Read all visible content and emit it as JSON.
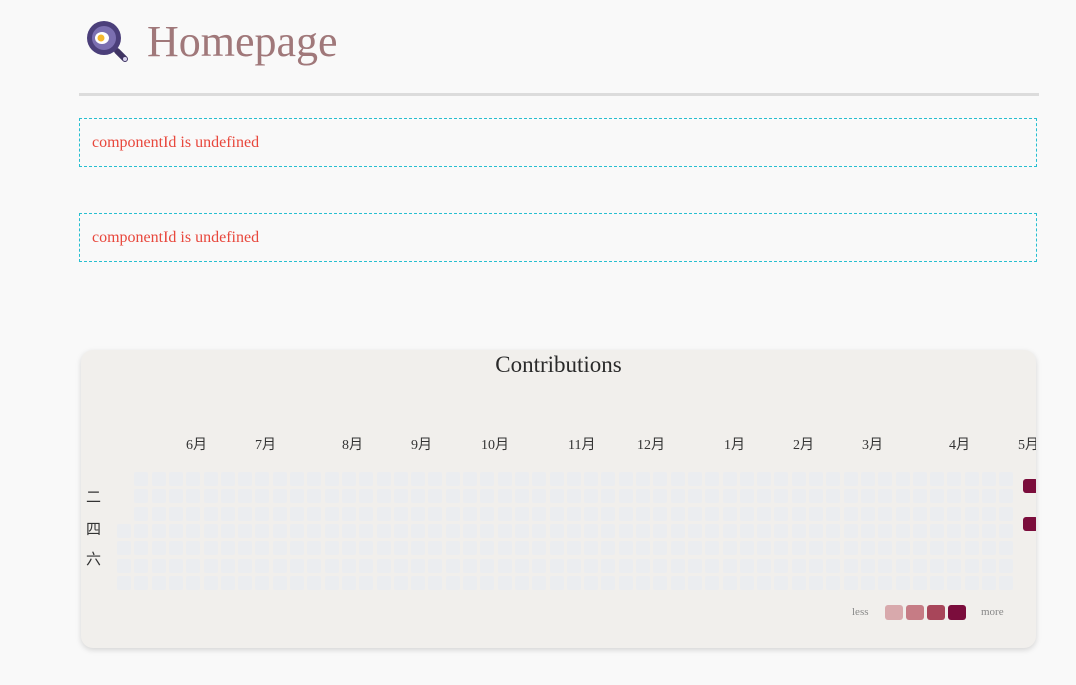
{
  "header": {
    "title": "Homepage",
    "logo_icon": "magnifier-egg-logo-icon",
    "logo_colors": {
      "ring": "#4b3f7a",
      "inner": "#7b6fb0",
      "yolk": "#f5b82e",
      "white": "#ffffff"
    }
  },
  "errors": [
    {
      "message": "componentId is undefined"
    },
    {
      "message": "componentId is undefined"
    }
  ],
  "contributions": {
    "title": "Contributions",
    "months": [
      "6月",
      "7月",
      "8月",
      "9月",
      "10月",
      "11月",
      "12月",
      "1月",
      "2月",
      "3月",
      "4月",
      "5月"
    ],
    "weekdays": [
      "二",
      "四",
      "六"
    ],
    "legend": {
      "less": "less",
      "more": "more",
      "colors": [
        "#d8a9ac",
        "#c67c85",
        "#a8465a",
        "#7b0d3c"
      ]
    },
    "colors": {
      "empty": "#ebedf0",
      "highlight": "#7b0d3c"
    },
    "active_days": [
      {
        "week": "last",
        "weekday": "二",
        "level": 4
      },
      {
        "week": "last",
        "weekday": "四",
        "level": 4
      }
    ]
  }
}
